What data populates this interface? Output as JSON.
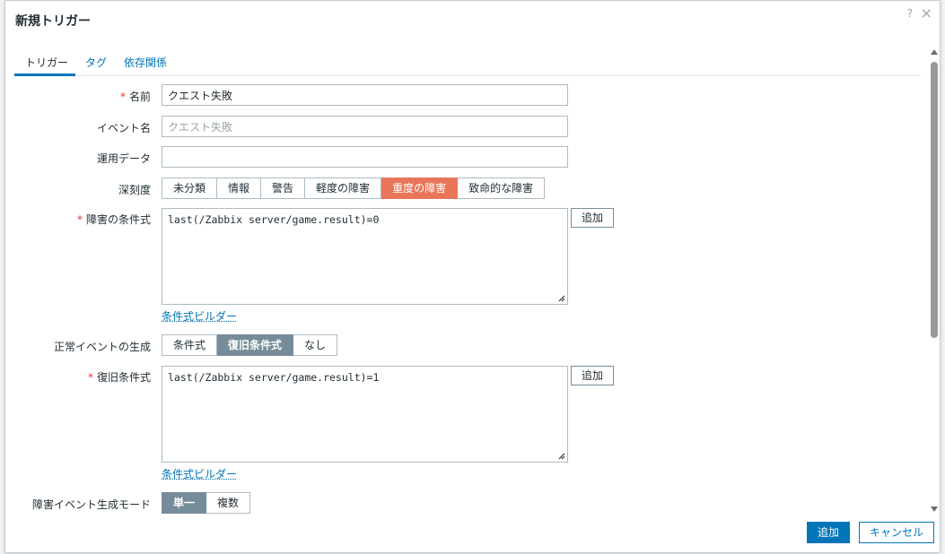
{
  "dialog": {
    "title": "新規トリガー",
    "help": "?",
    "close": "×"
  },
  "tabs": [
    {
      "label": "トリガー",
      "active": true
    },
    {
      "label": "タグ",
      "active": false
    },
    {
      "label": "依存関係",
      "active": false
    }
  ],
  "form": {
    "name": {
      "label": "名前",
      "required": "*",
      "value": "クエスト失敗"
    },
    "event_name": {
      "label": "イベント名",
      "placeholder": "クエスト失敗"
    },
    "opdata": {
      "label": "運用データ",
      "value": ""
    },
    "severity": {
      "label": "深刻度",
      "options": [
        "未分類",
        "情報",
        "警告",
        "軽度の障害",
        "重度の障害",
        "致命的な障害"
      ],
      "selected": "重度の障害"
    },
    "problem_expr": {
      "label": "障害の条件式",
      "required": "*",
      "value": "last(/Zabbix server/game.result)=0",
      "add": "追加",
      "builder": "条件式ビルダー"
    },
    "ok_event": {
      "label": "正常イベントの生成",
      "options": [
        "条件式",
        "復旧条件式",
        "なし"
      ],
      "selected": "復旧条件式"
    },
    "recovery_expr": {
      "label": "復旧条件式",
      "required": "*",
      "value": "last(/Zabbix server/game.result)=1",
      "add": "追加",
      "builder": "条件式ビルダー"
    },
    "event_mode": {
      "label": "障害イベント生成モード",
      "options": [
        "単一",
        "複数"
      ],
      "selected": "単一"
    }
  },
  "footer": {
    "add": "追加",
    "cancel": "キャンセル"
  },
  "colors": {
    "accent": "#0275b8",
    "severity_selected": "#e97659",
    "toggle_selected": "#768d99",
    "required": "#e33734"
  }
}
